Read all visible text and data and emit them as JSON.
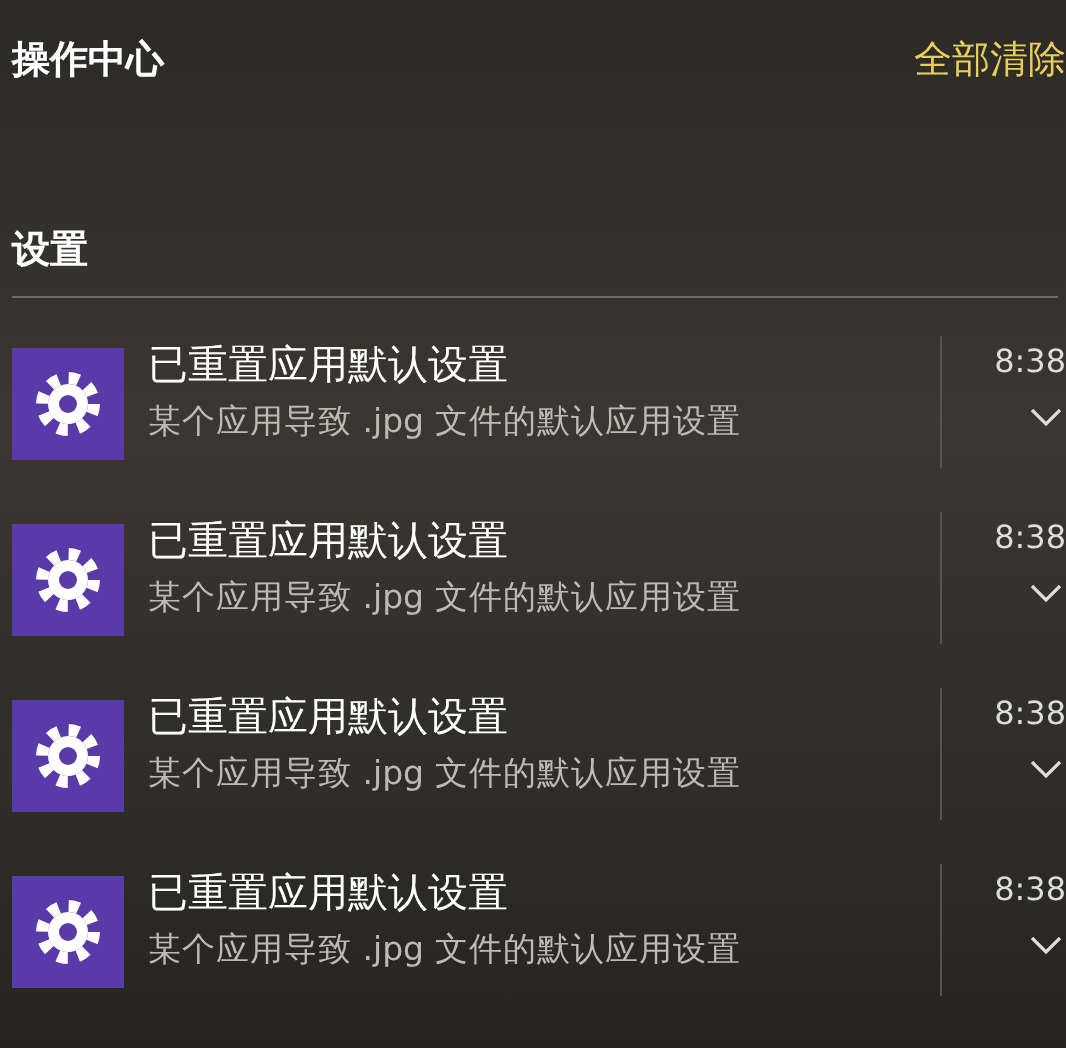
{
  "header": {
    "title": "操作中心",
    "clear_all": "全部清除"
  },
  "group": {
    "name": "设置"
  },
  "notifications": [
    {
      "title": "已重置应用默认设置",
      "body": "某个应用导致 .jpg 文件的默认应用设置",
      "time": "8:38",
      "expanded": false
    },
    {
      "title": "已重置应用默认设置",
      "body": "某个应用导致 .jpg 文件的默认应用设置",
      "time": "8:38",
      "expanded": false
    },
    {
      "title": "已重置应用默认设置",
      "body": "某个应用导致 .jpg 文件的默认应用设置",
      "time": "8:38",
      "expanded": false
    },
    {
      "title": "已重置应用默认设置",
      "body": "某个应用导致 .jpg 文件的默认应用设置",
      "time": "8:38",
      "expanded": false
    }
  ]
}
